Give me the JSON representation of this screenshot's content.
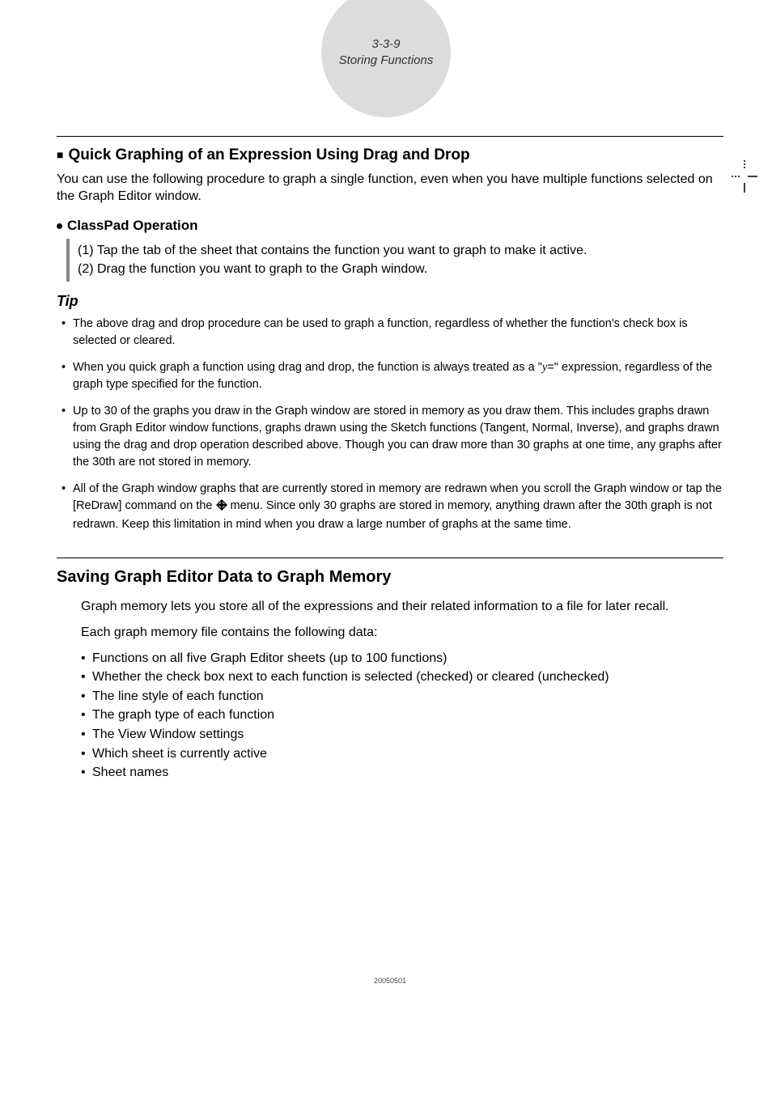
{
  "header": {
    "pagecode": "3-3-9",
    "chapter": "Storing Functions"
  },
  "sec1": {
    "title": "Quick Graphing of an Expression Using Drag and Drop",
    "intro": "You can use the following procedure to graph a single function, even when you have multiple functions selected on the Graph Editor window.",
    "op_title": "ClassPad Operation",
    "step1": "(1) Tap the tab of the sheet that contains the function you want to graph to make it active.",
    "step2": "(2) Drag the function you want to graph to the Graph window.",
    "tip_label": "Tip",
    "tips": {
      "t1": "The above drag and drop procedure can be used to graph a function, regardless of whether the function's check box is selected or cleared.",
      "t2a": "When you quick graph a function using drag and drop, the function is always treated as a \"",
      "t2y": "y",
      "t2b": "=\" expression, regardless of the graph type specified for the function.",
      "t3": "Up to 30 of the graphs you draw in the Graph window are stored in memory as you draw them. This includes graphs drawn from Graph Editor window functions, graphs drawn using the Sketch functions (Tangent, Normal, Inverse), and graphs drawn using the drag and drop operation described above. Though you can draw more than 30 graphs at one time, any graphs after the 30th are not stored in memory.",
      "t4a": "All of the Graph window graphs that are currently stored in memory are redrawn when you scroll the Graph window or tap the [ReDraw] command on the ",
      "t4b": " menu. Since only 30 graphs are stored in memory, anything drawn after the 30th graph is not redrawn. Keep this limitation in mind when you draw a large number of graphs at the same time."
    }
  },
  "sec2": {
    "title": "Saving Graph Editor Data to Graph Memory",
    "p1": "Graph memory lets you store all of the expressions and their related information to a file for later recall.",
    "p2": "Each graph memory file contains the following data:",
    "items": {
      "b1": "Functions on all five Graph Editor sheets (up to 100 functions)",
      "b2": "Whether the check box next to each function is selected (checked) or cleared (unchecked)",
      "b3": "The line style of each function",
      "b4": "The graph type of each function",
      "b5": "The View Window settings",
      "b6": "Which sheet is currently active",
      "b7": "Sheet names"
    }
  },
  "footer_id": "20050501"
}
